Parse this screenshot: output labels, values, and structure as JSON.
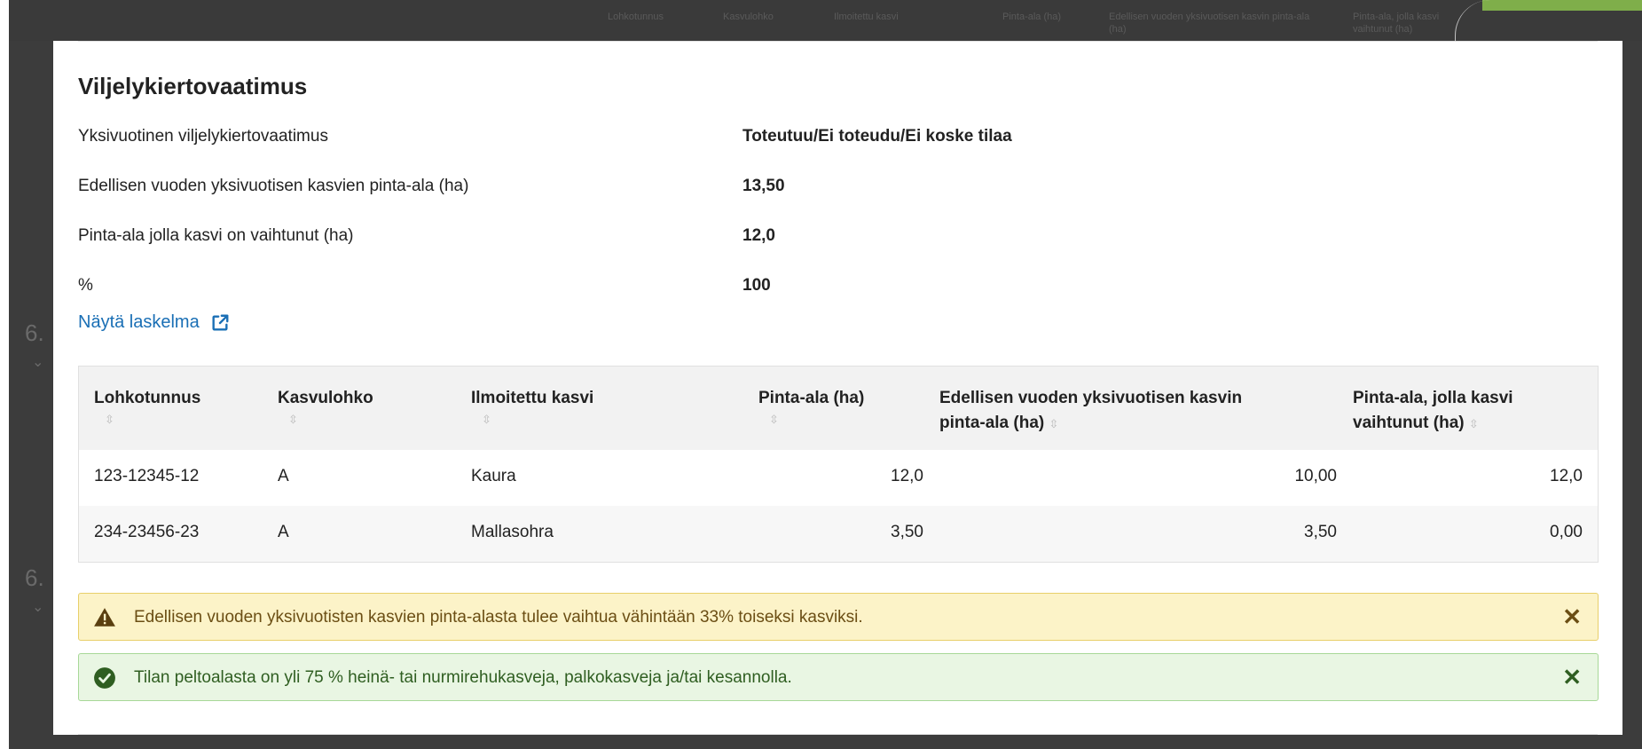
{
  "background": {
    "table_headers": [
      "Lohkotunnus",
      "Kasvulohko",
      "Ilmoitettu kasvi",
      "Pinta-ala (ha)",
      "Edellisen vuoden yksivuotisen kasvin pinta-ala (ha)",
      "Pinta-ala, jolla kasvi vaihtunut (ha)"
    ],
    "section_digit_1": "6.",
    "section_digit_2": "6."
  },
  "modal": {
    "title": "Viljelykiertovaatimus",
    "info": [
      {
        "label": "Yksivuotinen viljelykiertovaatimus",
        "value": "Toteutuu/Ei toteudu/Ei koske tilaa"
      },
      {
        "label": "Edellisen vuoden yksivuotisen kasvien pinta-ala (ha)",
        "value": "13,50"
      },
      {
        "label": "Pinta-ala jolla kasvi on vaihtunut (ha)",
        "value": "12,0"
      },
      {
        "label": "%",
        "value": "100"
      }
    ],
    "calc_link": "Näytä laskelma",
    "table": {
      "headers": [
        {
          "line1": "Lohkotunnus",
          "line2": ""
        },
        {
          "line1": "Kasvulohko",
          "line2": ""
        },
        {
          "line1": "Ilmoitettu kasvi",
          "line2": ""
        },
        {
          "line1": "Pinta-ala (ha)",
          "line2": ""
        },
        {
          "line1": "Edellisen vuoden yksivuotisen kasvin",
          "line2": "pinta-ala (ha)"
        },
        {
          "line1": "Pinta-ala, jolla kasvi",
          "line2": "vaihtunut (ha)"
        }
      ],
      "rows": [
        [
          "123-12345-12",
          "A",
          "Kaura",
          "12,0",
          "10,00",
          "12,0"
        ],
        [
          "234-23456-23",
          "A",
          "Mallasohra",
          "3,50",
          "3,50",
          "0,00"
        ]
      ]
    },
    "alerts": {
      "warning": "Edellisen vuoden yksivuotisten kasvien pinta-alasta tulee vaihtua vähintään 33% toiseksi kasviksi.",
      "success": "Tilan peltoalasta on yli 75 % heinä- tai nurmirehukasveja, palkokasveja ja/tai kesannolla."
    },
    "sort_glyph": "⇳",
    "close_glyph": "✕",
    "colors": {
      "link": "#1a6fb5",
      "warning_bg": "#fcf3c8",
      "success_bg": "#e9f6e3"
    }
  }
}
